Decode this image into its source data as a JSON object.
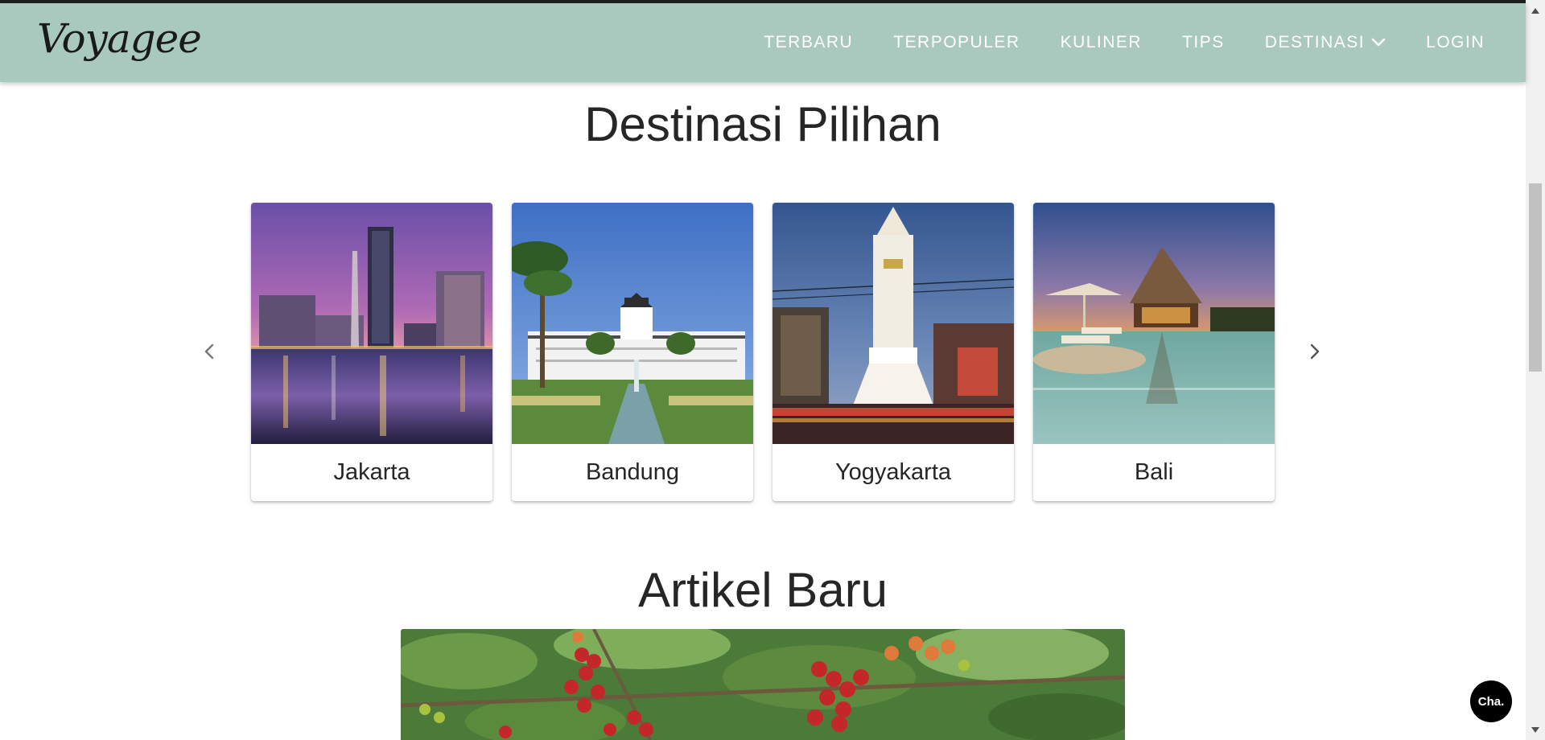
{
  "brand": {
    "name": "Voyagee"
  },
  "nav": {
    "items": [
      {
        "label": "TERBARU"
      },
      {
        "label": "TERPOPULER"
      },
      {
        "label": "KULINER"
      },
      {
        "label": "TIPS"
      },
      {
        "label": "DESTINASI",
        "icon": "chevron-down-icon"
      },
      {
        "label": "LOGIN"
      }
    ]
  },
  "destinations": {
    "title": "Destinasi Pilihan",
    "cards": [
      {
        "label": "Jakarta"
      },
      {
        "label": "Bandung"
      },
      {
        "label": "Yogyakarta"
      },
      {
        "label": "Bali"
      }
    ],
    "prev_icon": "chevron-left-icon",
    "next_icon": "chevron-right-icon"
  },
  "articles": {
    "title": "Artikel Baru"
  },
  "chat": {
    "label": "Cha."
  },
  "colors": {
    "navbar": "#a9c9bf",
    "nav_text": "#ffffff",
    "heading": "#262626"
  }
}
